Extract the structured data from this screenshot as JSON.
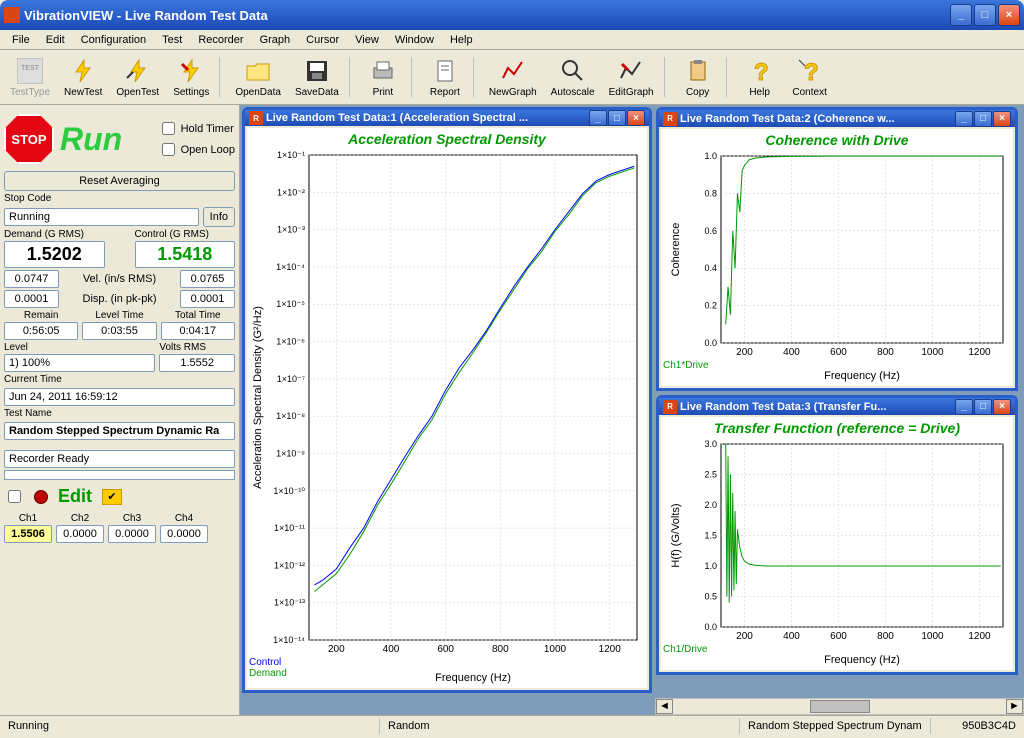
{
  "window": {
    "title": "VibrationVIEW - Live Random Test Data"
  },
  "menu": [
    "File",
    "Edit",
    "Configuration",
    "Test",
    "Recorder",
    "Graph",
    "Cursor",
    "View",
    "Window",
    "Help"
  ],
  "toolbar": [
    {
      "label": "TestType",
      "disabled": true
    },
    {
      "label": "NewTest"
    },
    {
      "label": "OpenTest"
    },
    {
      "label": "Settings"
    },
    {
      "sep": true
    },
    {
      "label": "OpenData"
    },
    {
      "label": "SaveData"
    },
    {
      "sep": true
    },
    {
      "label": "Print"
    },
    {
      "sep": true
    },
    {
      "label": "Report"
    },
    {
      "sep": true
    },
    {
      "label": "NewGraph"
    },
    {
      "label": "Autoscale"
    },
    {
      "label": "EditGraph"
    },
    {
      "sep": true
    },
    {
      "label": "Copy"
    },
    {
      "sep": true
    },
    {
      "label": "Help"
    },
    {
      "label": "Context"
    }
  ],
  "left": {
    "stop_text": "STOP",
    "run_text": "Run",
    "hold_timer": "Hold Timer",
    "open_loop": "Open Loop",
    "reset_avg": "Reset Averaging",
    "stop_code_label": "Stop Code",
    "stop_code": "Running",
    "info_btn": "Info",
    "demand_label": "Demand (G RMS)",
    "demand": "1.5202",
    "control_label": "Control (G RMS)",
    "control": "1.5418",
    "vel_d": "0.0747",
    "vel_label": "Vel. (in/s RMS)",
    "vel_c": "0.0765",
    "disp_d": "0.0001",
    "disp_label": "Disp. (in pk-pk)",
    "disp_c": "0.0001",
    "remain_label": "Remain",
    "remain": "0:56:05",
    "leveltime_label": "Level Time",
    "leveltime": "0:03:55",
    "totaltime_label": "Total Time",
    "totaltime": "0:04:17",
    "level_label": "Level",
    "level": "1) 100%",
    "volts_label": "Volts RMS",
    "volts": "1.5552",
    "curtime_label": "Current Time",
    "curtime": "Jun 24, 2011 16:59:12",
    "testname_label": "Test Name",
    "testname": "Random Stepped Spectrum Dynamic Ra",
    "recorder": "Recorder Ready",
    "edit_text": "Edit",
    "channels": {
      "ch1": {
        "label": "Ch1",
        "val": "1.5506"
      },
      "ch2": {
        "label": "Ch2",
        "val": "0.0000"
      },
      "ch3": {
        "label": "Ch3",
        "val": "0.0000"
      },
      "ch4": {
        "label": "Ch4",
        "val": "0.0000"
      }
    }
  },
  "windows": {
    "w1": {
      "title": "Live Random Test Data:1 (Acceleration Spectral ...",
      "chart_title": "Acceleration Spectral Density",
      "xlabel": "Frequency (Hz)",
      "ylabel": "Acceleration Spectral Density (G²/Hz)",
      "legend1": "Control",
      "legend1_color": "#0000ff",
      "legend2": "Demand",
      "legend2_color": "#009900"
    },
    "w2": {
      "title": "Live Random Test Data:2 (Coherence w...",
      "chart_title": "Coherence with Drive",
      "xlabel": "Frequency (Hz)",
      "ylabel": "Coherence",
      "legend": "Ch1*Drive"
    },
    "w3": {
      "title": "Live Random Test Data:3 (Transfer Fu...",
      "chart_title": "Transfer Function (reference = Drive)",
      "xlabel": "Frequency (Hz)",
      "ylabel": "H(f) (G/Volts)",
      "legend": "Ch1/Drive"
    }
  },
  "status": {
    "left": "Running",
    "mid": "Random",
    "right1": "Random Stepped Spectrum Dynam",
    "right2": "950B3C4D"
  },
  "chart_data": [
    {
      "type": "line",
      "title": "Acceleration Spectral Density",
      "xlabel": "Frequency (Hz)",
      "ylabel": "Acceleration Spectral Density (G²/Hz)",
      "xlim": [
        100,
        1300
      ],
      "ylim": [
        1e-14,
        0.1
      ],
      "yscale": "log",
      "xticks": [
        200,
        400,
        600,
        800,
        1000,
        1200
      ],
      "yticks": [
        1e-14,
        1e-13,
        1e-12,
        1e-11,
        1e-10,
        1e-09,
        1e-08,
        1e-07,
        1e-06,
        1e-05,
        0.0001,
        0.001,
        0.01,
        0.1
      ],
      "series": [
        {
          "name": "Control",
          "color": "#0000ff",
          "x": [
            120,
            150,
            200,
            250,
            300,
            350,
            400,
            450,
            500,
            550,
            600,
            650,
            700,
            750,
            800,
            850,
            900,
            950,
            1000,
            1050,
            1100,
            1150,
            1200,
            1250,
            1290
          ],
          "y": [
            3e-13,
            4e-13,
            8e-13,
            3e-12,
            1e-11,
            5e-11,
            2e-10,
            8e-10,
            3e-09,
            1e-08,
            5e-08,
            2e-07,
            6e-07,
            2e-06,
            8e-06,
            3e-05,
            0.0001,
            0.0003,
            0.001,
            0.003,
            0.009,
            0.02,
            0.03,
            0.04,
            0.05
          ]
        },
        {
          "name": "Demand",
          "color": "#009900",
          "x": [
            120,
            150,
            200,
            250,
            300,
            350,
            400,
            450,
            500,
            550,
            600,
            650,
            700,
            750,
            800,
            850,
            900,
            950,
            1000,
            1050,
            1100,
            1150,
            1200,
            1250,
            1290
          ],
          "y": [
            2e-13,
            3e-13,
            6e-13,
            2e-12,
            8e-12,
            4e-11,
            1.5e-10,
            6e-10,
            2.5e-09,
            8e-09,
            4e-08,
            1.5e-07,
            5e-07,
            1.8e-06,
            7e-06,
            2.5e-05,
            9e-05,
            0.00025,
            0.0009,
            0.0025,
            0.008,
            0.018,
            0.027,
            0.036,
            0.045
          ]
        }
      ]
    },
    {
      "type": "line",
      "title": "Coherence with Drive",
      "xlabel": "Frequency (Hz)",
      "ylabel": "Coherence",
      "xlim": [
        100,
        1300
      ],
      "ylim": [
        0,
        1
      ],
      "xticks": [
        200,
        400,
        600,
        800,
        1000,
        1200
      ],
      "yticks": [
        0,
        0.2,
        0.4,
        0.6,
        0.8,
        1.0
      ],
      "series": [
        {
          "name": "Ch1*Drive",
          "color": "#009900",
          "x": [
            120,
            130,
            140,
            150,
            160,
            170,
            180,
            190,
            200,
            220,
            250,
            300,
            400,
            600,
            800,
            1000,
            1200,
            1290
          ],
          "y": [
            0.1,
            0.3,
            0.15,
            0.6,
            0.4,
            0.8,
            0.7,
            0.92,
            0.95,
            0.98,
            0.99,
            0.995,
            0.998,
            0.999,
            0.999,
            0.999,
            0.999,
            0.999
          ]
        }
      ]
    },
    {
      "type": "line",
      "title": "Transfer Function (reference = Drive)",
      "xlabel": "Frequency (Hz)",
      "ylabel": "H(f) (G/Volts)",
      "xlim": [
        100,
        1300
      ],
      "ylim": [
        0,
        3
      ],
      "xticks": [
        200,
        400,
        600,
        800,
        1000,
        1200
      ],
      "yticks": [
        0,
        0.5,
        1.0,
        1.5,
        2.0,
        2.5,
        3.0
      ],
      "series": [
        {
          "name": "Ch1/Drive",
          "color": "#009900",
          "x": [
            120,
            125,
            130,
            135,
            140,
            145,
            150,
            155,
            160,
            165,
            170,
            180,
            190,
            200,
            220,
            250,
            300,
            400,
            600,
            800,
            1000,
            1200,
            1290
          ],
          "y": [
            3.0,
            0.5,
            2.8,
            0.4,
            2.5,
            0.5,
            2.2,
            0.6,
            1.9,
            0.7,
            1.6,
            1.3,
            1.15,
            1.08,
            1.03,
            1.01,
            1.0,
            1.0,
            1.0,
            1.0,
            1.0,
            1.0,
            1.0
          ]
        }
      ]
    }
  ]
}
